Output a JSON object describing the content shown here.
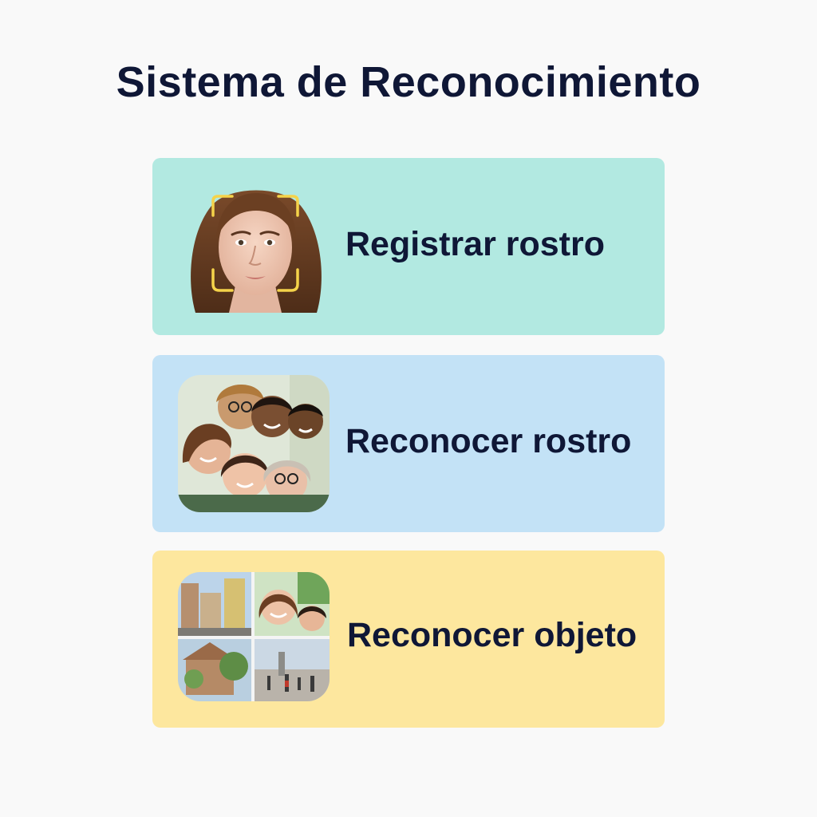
{
  "page": {
    "title": "Sistema de Reconocimiento"
  },
  "options": [
    {
      "label": "Registrar rostro",
      "icon": "single-face-scan-icon",
      "background": "#b2e9e1"
    },
    {
      "label": "Reconocer rostro",
      "icon": "group-faces-icon",
      "background": "#c3e2f6"
    },
    {
      "label": "Reconocer objeto",
      "icon": "scene-collage-icon",
      "background": "#fde79e"
    }
  ],
  "colors": {
    "text": "#0f1736",
    "page_background": "#f9f9f9",
    "scan_frame": "#f5d34a"
  }
}
